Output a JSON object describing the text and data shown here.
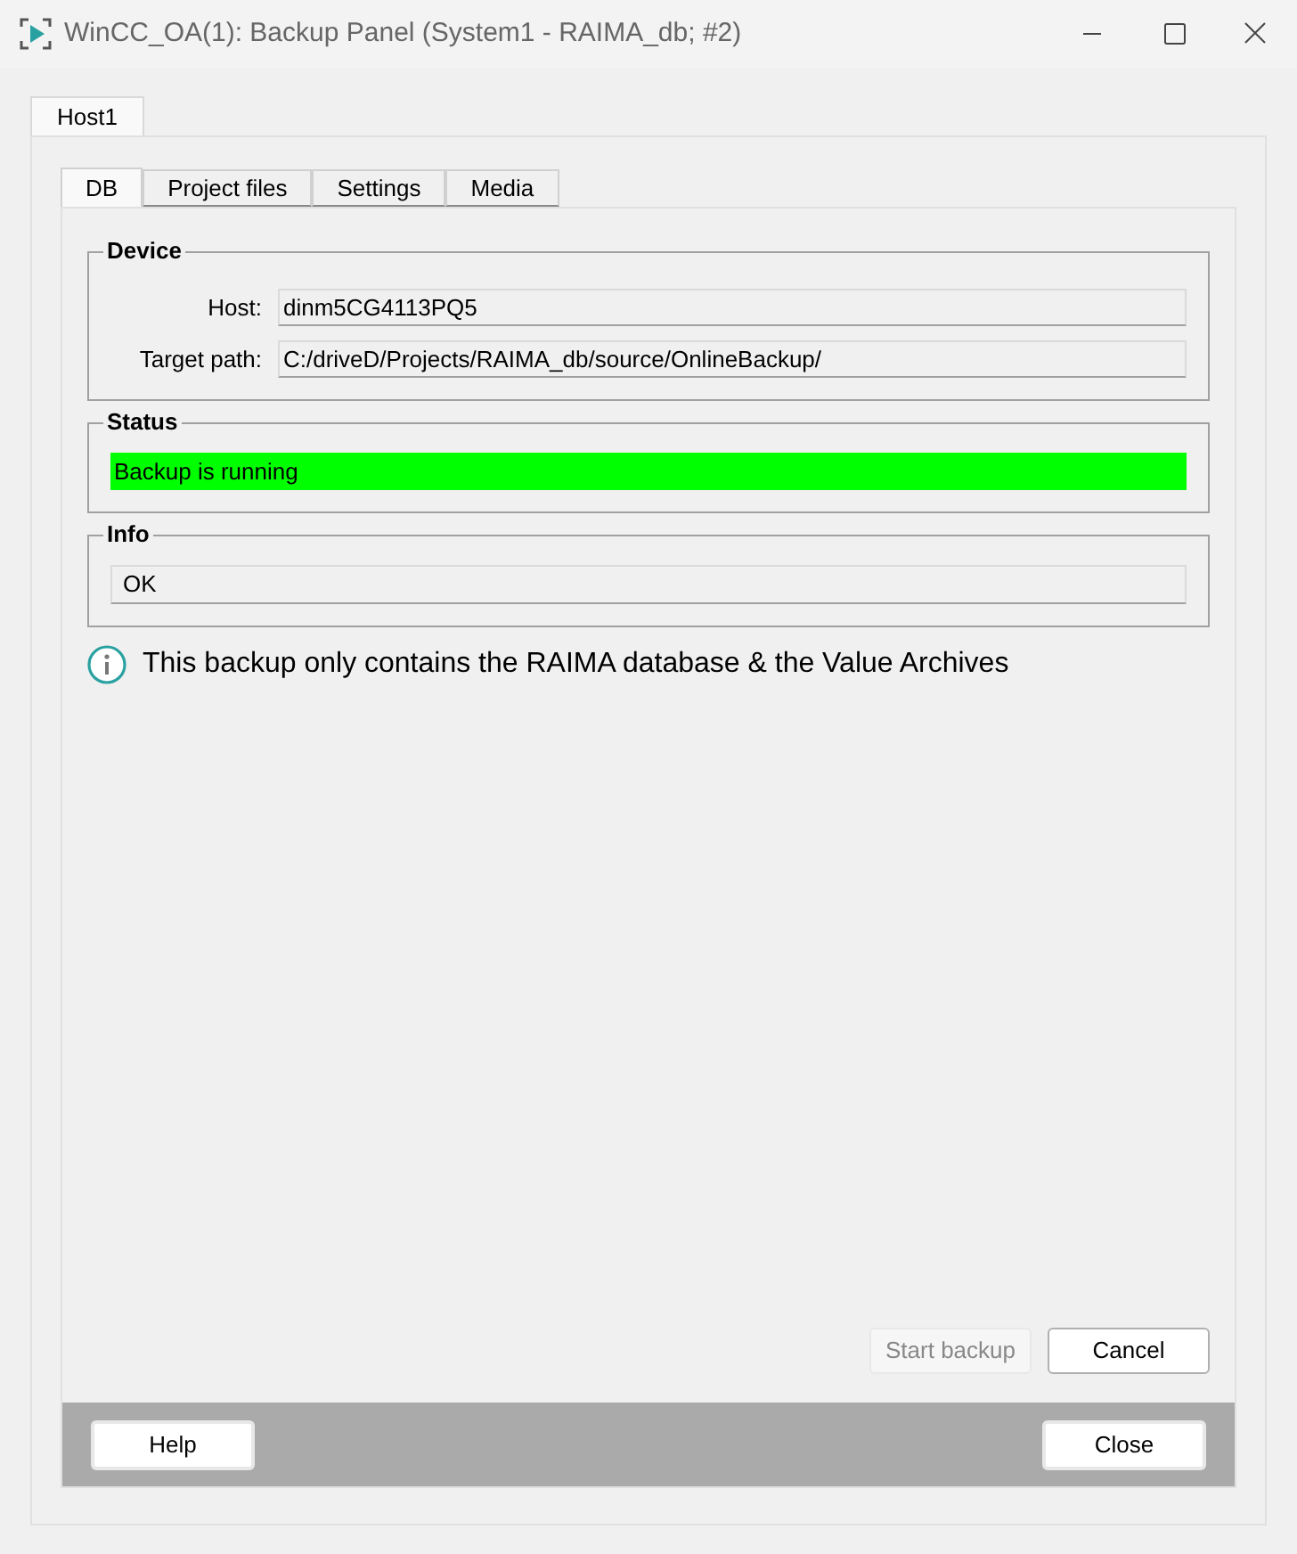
{
  "window": {
    "title": "WinCC_OA(1): Backup Panel (System1 - RAIMA_db; #2)"
  },
  "host_tabs": [
    {
      "label": "Host1",
      "selected": true
    }
  ],
  "tabs": [
    {
      "label": "DB",
      "selected": true
    },
    {
      "label": "Project files",
      "selected": false
    },
    {
      "label": "Settings",
      "selected": false
    },
    {
      "label": "Media",
      "selected": false
    }
  ],
  "device": {
    "title": "Device",
    "fields": [
      {
        "label": "Host:",
        "value": "dinm5CG4113PQ5"
      },
      {
        "label": "Target path:",
        "value": "C:/driveD/Projects/RAIMA_db/source/OnlineBackup/"
      }
    ]
  },
  "status": {
    "title": "Status",
    "value": "Backup is running",
    "color": "#00ff00"
  },
  "info": {
    "title": "Info",
    "value": "OK"
  },
  "note": "This backup only contains the RAIMA database & the Value Archives",
  "actions": [
    {
      "label": "Start backup",
      "disabled": true
    },
    {
      "label": "Cancel",
      "disabled": false
    }
  ],
  "footer": {
    "help": "Help",
    "close": "Close"
  }
}
